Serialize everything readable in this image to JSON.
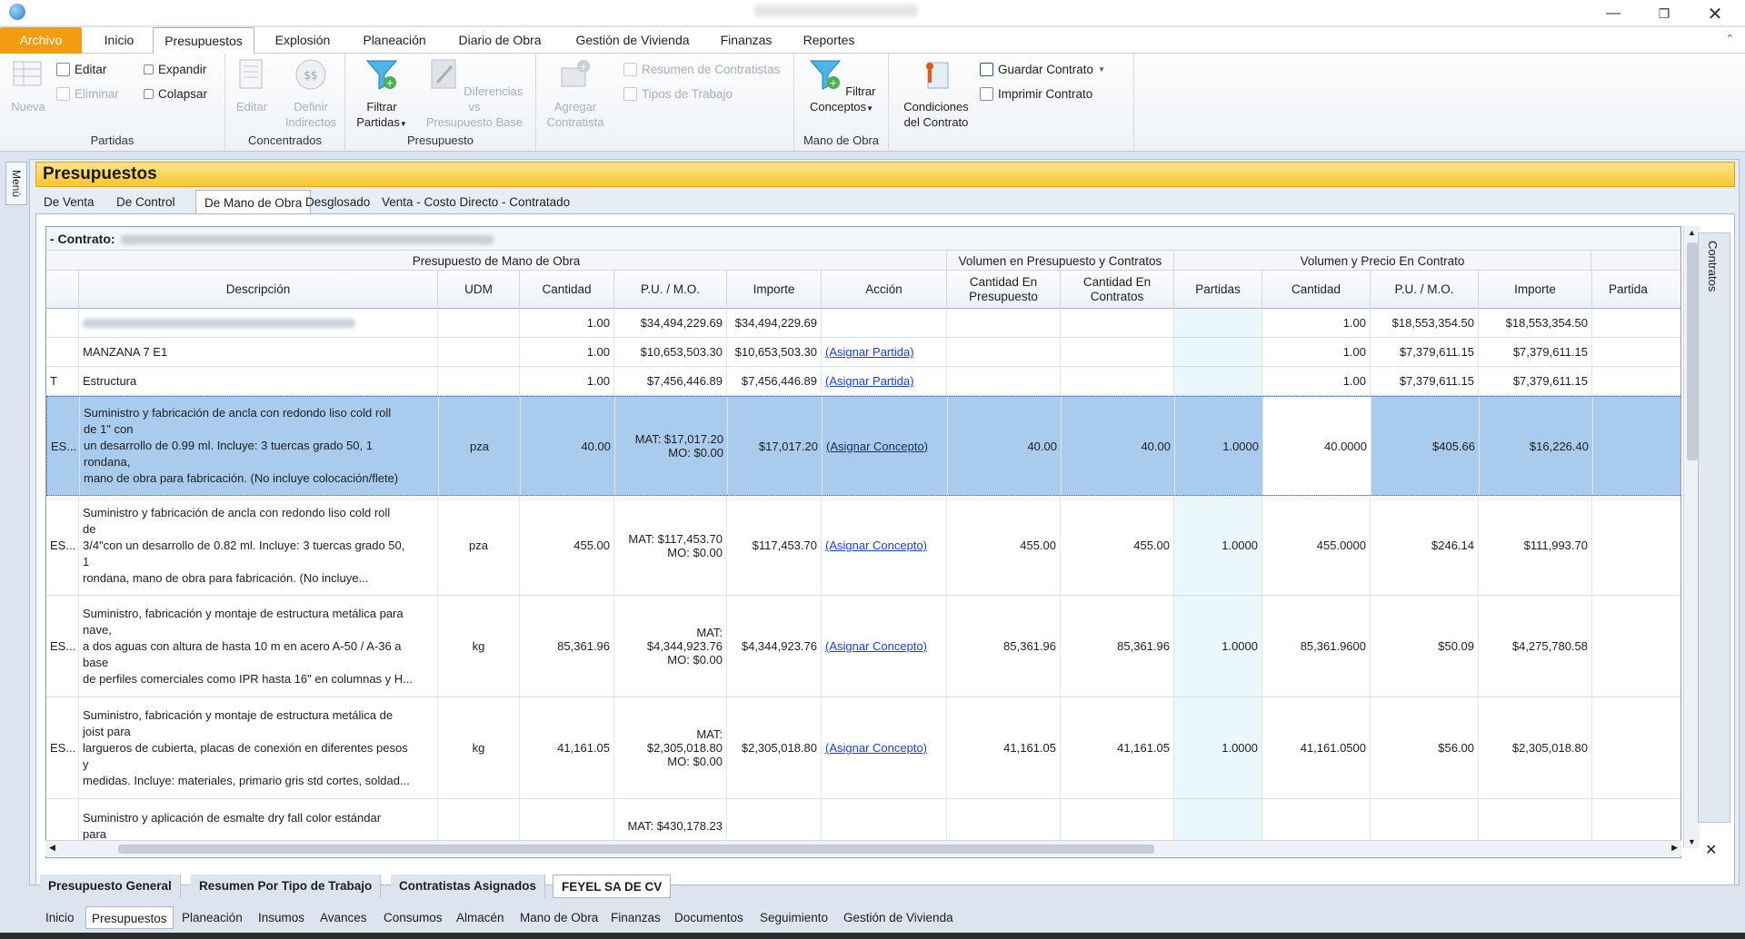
{
  "ribbon_tabs": [
    "Archivo",
    "Inicio",
    "Presupuestos",
    "Explosión",
    "Planeación",
    "Diario de Obra",
    "Gestión de Vivienda",
    "Finanzas",
    "Reportes"
  ],
  "ribbon": {
    "partidas": {
      "nueva": "Nueva",
      "editar": "Editar",
      "eliminar": "Eliminar",
      "expandir": "Expandir",
      "colapsar": "Colapsar",
      "label": "Partidas"
    },
    "concentrados": {
      "editar": "Editar",
      "definir_1": "Definir",
      "definir_2": "Indirectos",
      "label": "Concentrados"
    },
    "presupuesto": {
      "filtrar_1": "Filtrar",
      "filtrar_2": "Partidas",
      "dif_1": "Diferencias vs",
      "dif_2": "Presupuesto Base",
      "label": "Presupuesto"
    },
    "contratistas": {
      "agregar_1": "Agregar",
      "agregar_2": "Contratista",
      "resumen": "Resumen de Contratistas",
      "tipos": "Tipos de Trabajo"
    },
    "mano_obra": {
      "filtrar_1": "Filtrar",
      "filtrar_2": "Conceptos",
      "label": "Mano de Obra"
    },
    "contrato": {
      "cond_1": "Condiciones",
      "cond_2": "del Contrato",
      "guardar": "Guardar Contrato",
      "imprimir": "Imprimir Contrato"
    }
  },
  "left_menu": "Menú",
  "panel_title": "Presupuestos",
  "sub_tabs": [
    "De Venta",
    "De Control",
    "De Mano de Obra",
    "Desglosado",
    "Venta - Costo Directo - Contratado"
  ],
  "contract_label": "- Contrato:",
  "bands": [
    "Presupuesto de Mano de Obra",
    "Volumen en Presupuesto y Contratos",
    "Volumen y Precio En Contrato"
  ],
  "columns": {
    "descripcion": "Descripción",
    "udm": "UDM",
    "cantidad": "Cantidad",
    "pu_mo": "P.U. / M.O.",
    "importe": "Importe",
    "accion": "Acción",
    "cant_pres": "Cantidad En\nPresupuesto",
    "cant_contr": "Cantidad En\nContratos",
    "partidas": "Partidas",
    "cantidad2": "Cantidad",
    "pu_mo2": "P.U. / M.O.",
    "importe2": "Importe",
    "partida_cut": "Partida"
  },
  "rows": [
    {
      "code": "",
      "desc": "",
      "udm": "",
      "cantidad": "1.00",
      "pu": "$34,494,229.69",
      "importe": "$34,494,229.69",
      "accion": "",
      "cant_pres": "",
      "cant_contr": "",
      "partidas": "",
      "cantidad2": "1.00",
      "pu2": "$18,553,354.50",
      "importe2": "$18,553,354.50"
    },
    {
      "code": "",
      "desc": "MANZANA 7 E1",
      "udm": "",
      "cantidad": "1.00",
      "pu": "$10,653,503.30",
      "importe": "$10,653,503.30",
      "accion": "(Asignar Partida)",
      "cant_pres": "",
      "cant_contr": "",
      "partidas": "",
      "cantidad2": "1.00",
      "pu2": "$7,379,611.15",
      "importe2": "$7,379,611.15"
    },
    {
      "code": "T",
      "desc": "Estructura",
      "udm": "",
      "cantidad": "1.00",
      "pu": "$7,456,446.89",
      "importe": "$7,456,446.89",
      "accion": "(Asignar Partida)",
      "cant_pres": "",
      "cant_contr": "",
      "partidas": "",
      "cantidad2": "1.00",
      "pu2": "$7,379,611.15",
      "importe2": "$7,379,611.15"
    },
    {
      "code": "ES...",
      "desc": "Suministro y fabricación de ancla con redondo liso cold roll\nde 1\" con\nun desarrollo de 0.99 ml. Incluye: 3 tuercas grado 50, 1\nrondana,\nmano de obra para fabricación. (No incluye colocación/flete)",
      "udm": "pza",
      "cantidad": "40.00",
      "pu": "MAT: $17,017.20\nMO: $0.00",
      "importe": "$17,017.20",
      "accion": "(Asignar Concepto)",
      "cant_pres": "40.00",
      "cant_contr": "40.00",
      "partidas": "1.0000",
      "cantidad2": "40.0000",
      "pu2": "$405.66",
      "importe2": "$16,226.40"
    },
    {
      "code": "ES...",
      "desc": "Suministro y fabricación de ancla con redondo liso cold roll\nde\n3/4\"con un desarrollo de 0.82 ml. Incluye: 3 tuercas grado 50,\n1\nrondana, mano de obra para fabricación. (No incluye...",
      "udm": "pza",
      "cantidad": "455.00",
      "pu": "MAT: $117,453.70\nMO: $0.00",
      "importe": "$117,453.70",
      "accion": "(Asignar Concepto)",
      "cant_pres": "455.00",
      "cant_contr": "455.00",
      "partidas": "1.0000",
      "cantidad2": "455.0000",
      "pu2": "$246.14",
      "importe2": "$111,993.70"
    },
    {
      "code": "ES...",
      "desc": "Suministro, fabricación y montaje de estructura metálica para\nnave,\na dos aguas con altura de hasta 10 m en acero A-50 / A-36 a\nbase\nde perfiles comerciales como IPR hasta 16\" en columnas y H...",
      "udm": "kg",
      "cantidad": "85,361.96",
      "pu": "MAT:\n$4,344,923.76\nMO: $0.00",
      "importe": "$4,344,923.76",
      "accion": "(Asignar Concepto)",
      "cant_pres": "85,361.96",
      "cant_contr": "85,361.96",
      "partidas": "1.0000",
      "cantidad2": "85,361.9600",
      "pu2": "$50.09",
      "importe2": "$4,275,780.58"
    },
    {
      "code": "ES...",
      "desc": "Suministro, fabricación y montaje de estructura metálica de\njoist para\nlargueros de cubierta, placas de conexión en diferentes pesos\ny\nmedidas. Incluye: materiales, primario gris std cortes, soldad...",
      "udm": "kg",
      "cantidad": "41,161.05",
      "pu": "MAT:\n$2,305,018.80\nMO: $0.00",
      "importe": "$2,305,018.80",
      "accion": "(Asignar Concepto)",
      "cant_pres": "41,161.05",
      "cant_contr": "41,161.05",
      "partidas": "1.0000",
      "cantidad2": "41,161.0500",
      "pu2": "$56.00",
      "importe2": "$2,305,018.80"
    },
    {
      "code": "",
      "desc": "Suministro y aplicación de esmalte dry fall color estándar\npara",
      "udm": "",
      "cantidad": "",
      "pu": "MAT: $430,178.23",
      "importe": "",
      "accion": "",
      "cant_pres": "",
      "cant_contr": "",
      "partidas": "",
      "cantidad2": "",
      "pu2": "",
      "importe2": ""
    }
  ],
  "contratos_label": "Contratos",
  "bottom_tabs": [
    "Presupuesto General",
    "Resumen Por Tipo de Trabajo",
    "Contratistas Asignados",
    "FEYEL SA DE CV"
  ],
  "module_tabs": [
    "Inicio",
    "Presupuestos",
    "Planeación",
    "Insumos",
    "Avances",
    "Consumos",
    "Almacén",
    "Mano de Obra",
    "Finanzas",
    "Documentos",
    "Seguimiento",
    "Gestión de Vivienda"
  ],
  "colors": {
    "accent": "#f39c12",
    "header_yellow": "#f8c72f",
    "selection": "#a8cbee",
    "link": "#1a3fd6"
  }
}
